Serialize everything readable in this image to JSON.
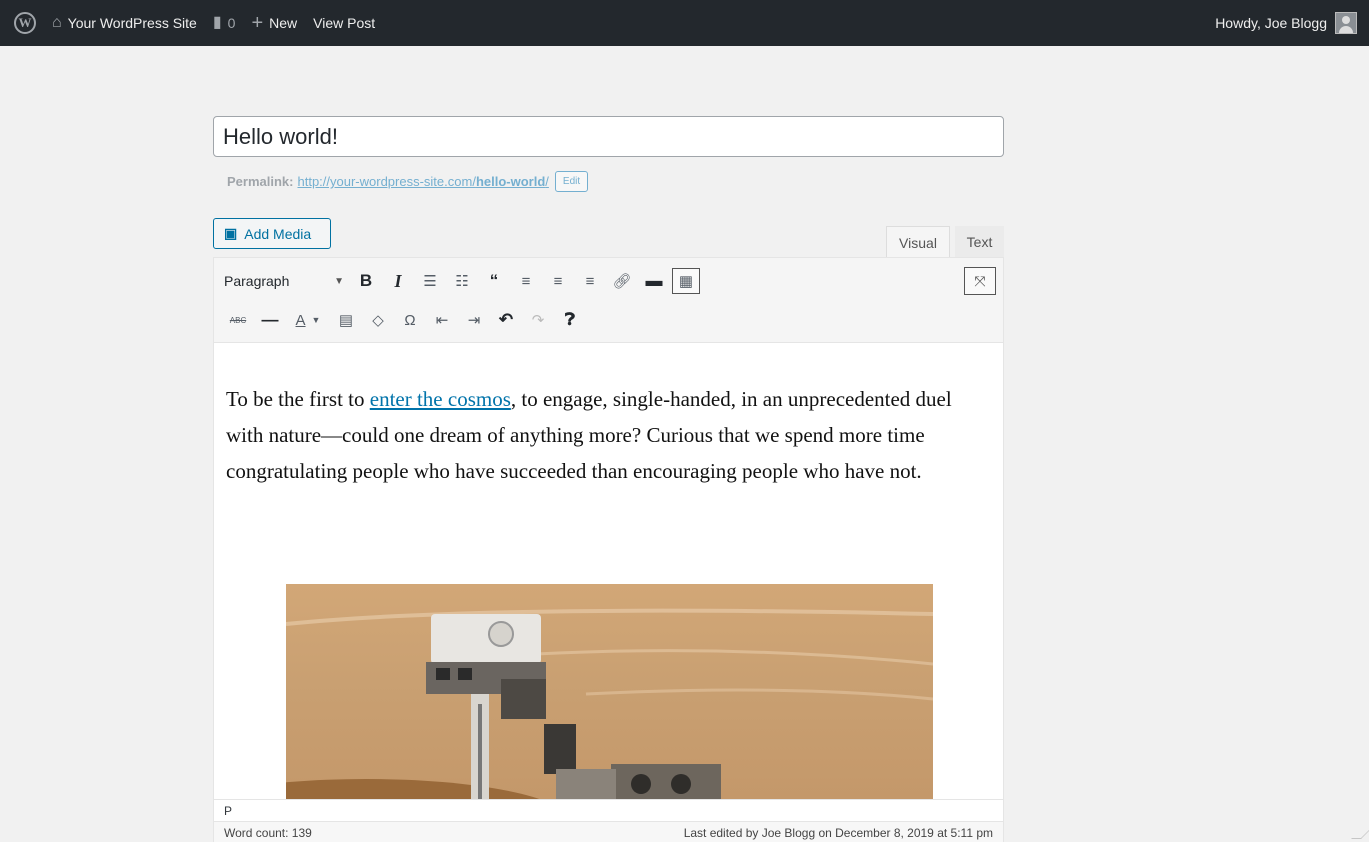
{
  "admin_bar": {
    "logo": "wordpress-logo-icon",
    "site_name": "Your WordPress Site",
    "comments_count": "0",
    "new_label": "New",
    "view_post_label": "View Post",
    "greeting": "Howdy, Joe Blogg"
  },
  "post": {
    "title": "Hello world!",
    "permalink_label": "Permalink:",
    "permalink_base": "http://your-wordpress-site.com/",
    "permalink_slug": "hello-world",
    "permalink_tail": "/",
    "edit_label": "Edit"
  },
  "editor": {
    "add_media_label": "Add Media",
    "tab_visual": "Visual",
    "tab_text": "Text",
    "format_value": "Paragraph",
    "format_caret": "▼",
    "text_color_label": "A",
    "toolbar_row1": [
      "bold",
      "italic",
      "bulleted-list",
      "numbered-list",
      "blockquote",
      "align-left",
      "align-center",
      "align-right",
      "insert-link",
      "read-more",
      "toolbar-toggle"
    ],
    "toolbar_row2": [
      "strikethrough",
      "horizontal-line",
      "text-color",
      "paste-as-text",
      "clear-formatting",
      "special-character",
      "decrease-indent",
      "increase-indent",
      "undo",
      "redo",
      "keyboard-shortcuts"
    ],
    "content": {
      "intro": "To be the first to ",
      "link_text": "enter the cosmos",
      "rest": ", to engage, single-handed, in an unprecedented duel with nature—could one dream of anything more? Curious that we spend more time congratulating people who have succeeded than encouraging people who have not."
    },
    "path": "P",
    "word_count": "Word count: 139",
    "last_edited": "Last edited by Joe Blogg on December 8, 2019 at 5:11 pm"
  },
  "colors": {
    "admin_bar_bg": "#23282d",
    "link": "#0073aa",
    "button_blue": "#0071a1"
  }
}
